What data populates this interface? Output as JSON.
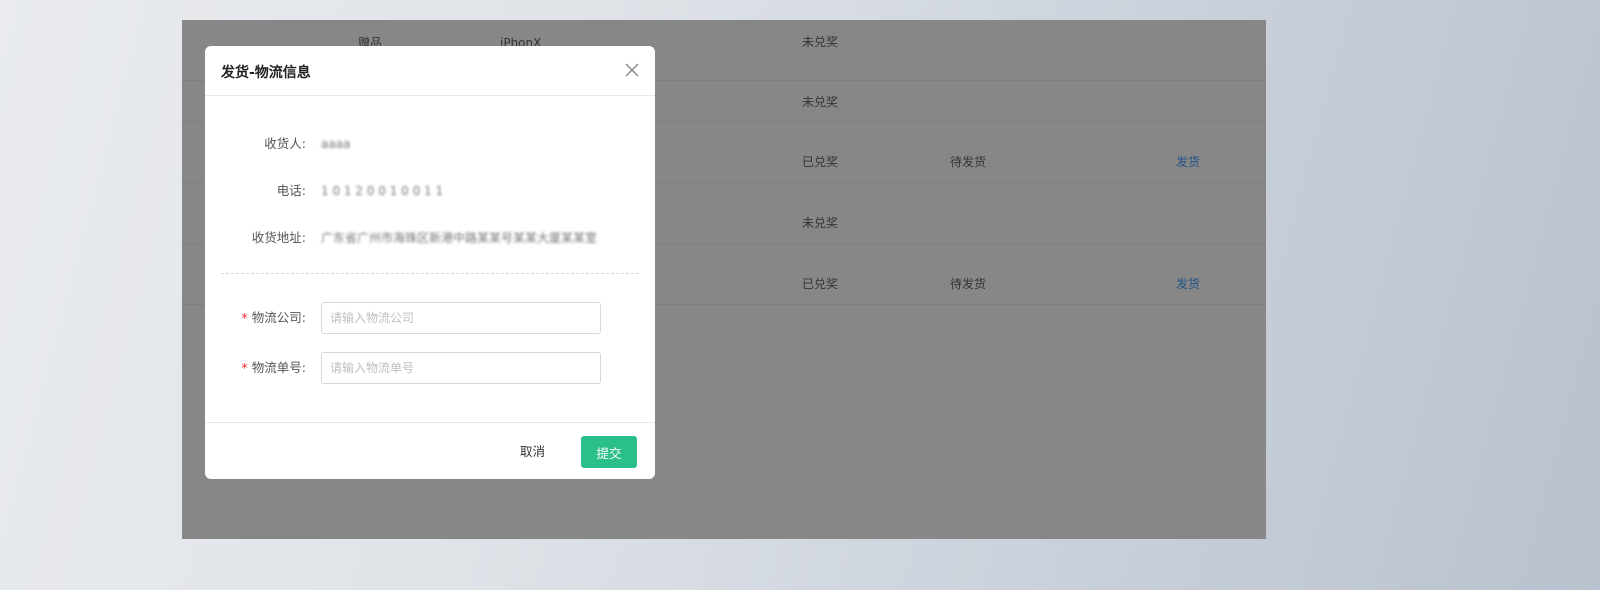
{
  "table": {
    "rows": [
      {
        "type": "赠品",
        "prize": "iPhonX",
        "status": "未兑奖",
        "ship": "",
        "action": ""
      },
      {
        "type": "",
        "prize": "",
        "status": "未兑奖",
        "ship": "",
        "action": ""
      },
      {
        "type": "",
        "prize": "",
        "status": "已兑奖",
        "ship": "待发货",
        "action": "发货"
      },
      {
        "type": "",
        "prize": "",
        "status": "未兑奖",
        "ship": "",
        "action": ""
      },
      {
        "type": "",
        "prize": "",
        "status": "已兑奖",
        "ship": "待发货",
        "action": "发货"
      }
    ]
  },
  "dialog": {
    "title": "发货-物流信息",
    "close_icon": "close-icon",
    "info": {
      "receiver_label": "收货人:",
      "receiver_value": "aaaa",
      "phone_label": "电话:",
      "phone_value": "1 0 1 2 0 0 1 0 0 1 1",
      "address_label": "收货地址:",
      "address_value": "广东省广州市海珠区新港中路某某号某某大厦某某室"
    },
    "form": {
      "required_mark": "*",
      "company_label": "物流公司:",
      "company_placeholder": "请输入物流公司",
      "tracking_label": "物流单号:",
      "tracking_placeholder": "请输入物流单号"
    },
    "footer": {
      "cancel_label": "取消",
      "submit_label": "提交"
    }
  },
  "colors": {
    "primary": "#2bbf8a",
    "link": "#409eff",
    "required": "#f5222d"
  }
}
